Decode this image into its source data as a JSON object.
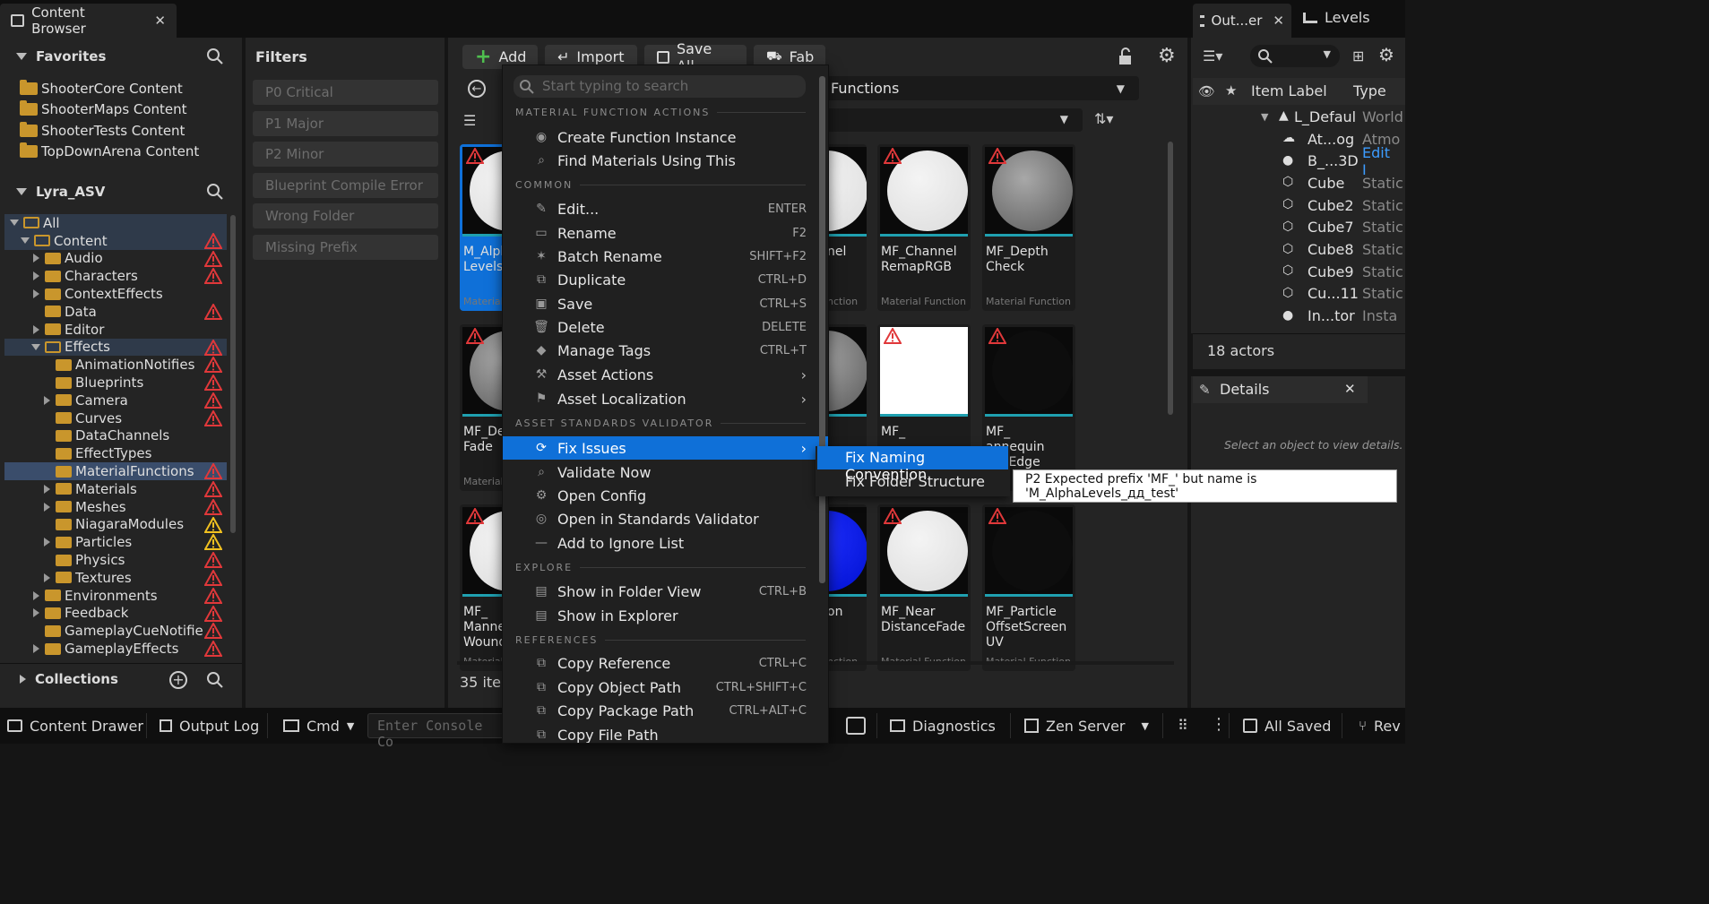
{
  "tabs": {
    "content_browser": "Content Browser",
    "close": "✕",
    "outliner": "Out...er",
    "levels": "Levels"
  },
  "favorites": {
    "title": "Favorites",
    "items": [
      "ShooterCore Content",
      "ShooterMaps Content",
      "ShooterTests Content",
      "TopDownArena Content"
    ]
  },
  "project": {
    "title": "Lyra_ASV"
  },
  "tree": [
    {
      "label": "All",
      "depth": 0,
      "exp": "open",
      "warn": ""
    },
    {
      "label": "Content",
      "depth": 1,
      "exp": "open",
      "warn": "red"
    },
    {
      "label": "Audio",
      "depth": 2,
      "exp": "closed",
      "warn": "red"
    },
    {
      "label": "Characters",
      "depth": 2,
      "exp": "closed",
      "warn": "red"
    },
    {
      "label": "ContextEffects",
      "depth": 2,
      "exp": "closed",
      "warn": ""
    },
    {
      "label": "Data",
      "depth": 2,
      "exp": "none",
      "warn": "red"
    },
    {
      "label": "Editor",
      "depth": 2,
      "exp": "closed",
      "warn": ""
    },
    {
      "label": "Effects",
      "depth": 2,
      "exp": "open",
      "warn": "red"
    },
    {
      "label": "AnimationNotifies",
      "depth": 3,
      "exp": "none",
      "warn": "red"
    },
    {
      "label": "Blueprints",
      "depth": 3,
      "exp": "none",
      "warn": "red"
    },
    {
      "label": "Camera",
      "depth": 3,
      "exp": "closed",
      "warn": "red"
    },
    {
      "label": "Curves",
      "depth": 3,
      "exp": "none",
      "warn": "red"
    },
    {
      "label": "DataChannels",
      "depth": 3,
      "exp": "none",
      "warn": ""
    },
    {
      "label": "EffectTypes",
      "depth": 3,
      "exp": "none",
      "warn": ""
    },
    {
      "label": "MaterialFunctions",
      "depth": 3,
      "exp": "none",
      "warn": "red"
    },
    {
      "label": "Materials",
      "depth": 3,
      "exp": "closed",
      "warn": "red"
    },
    {
      "label": "Meshes",
      "depth": 3,
      "exp": "closed",
      "warn": "red"
    },
    {
      "label": "NiagaraModules",
      "depth": 3,
      "exp": "none",
      "warn": "yellow"
    },
    {
      "label": "Particles",
      "depth": 3,
      "exp": "closed",
      "warn": "yellow"
    },
    {
      "label": "Physics",
      "depth": 3,
      "exp": "none",
      "warn": "red"
    },
    {
      "label": "Textures",
      "depth": 3,
      "exp": "closed",
      "warn": "red"
    },
    {
      "label": "Environments",
      "depth": 2,
      "exp": "closed",
      "warn": "red"
    },
    {
      "label": "Feedback",
      "depth": 2,
      "exp": "closed",
      "warn": "red"
    },
    {
      "label": "GameplayCueNotifie",
      "depth": 2,
      "exp": "none",
      "warn": "red"
    },
    {
      "label": "GameplayEffects",
      "depth": 2,
      "exp": "closed",
      "warn": "red"
    }
  ],
  "collections": {
    "title": "Collections"
  },
  "filters": {
    "title": "Filters",
    "items": [
      "P0 Critical",
      "P1 Major",
      "P2 Minor",
      "Blueprint Compile Error",
      "Wrong Folder",
      "Missing Prefix"
    ]
  },
  "toolbar": {
    "add": "Add",
    "import": "Import",
    "save_all": "Save All",
    "fab": "Fab"
  },
  "path": {
    "functions": "Functions"
  },
  "tiles": [
    {
      "name": "M_Alpha\nLevels",
      "kind": "Material",
      "style": "white",
      "sel": true
    },
    {
      "name": "MF_Channel\nRemapRGB",
      "kind": "Material Function",
      "style": "white"
    },
    {
      "name": "MF_Depth\nCheck",
      "kind": "Material Function",
      "style": "checker"
    },
    {
      "name": "MF_De\nFade",
      "kind": "Material",
      "style": "checker"
    },
    {
      "name": "MF_",
      "kind": "",
      "style": "square"
    },
    {
      "name": "MF_\nannequin\nnchEdge",
      "kind": "",
      "style": "black"
    },
    {
      "name": "MF_\nManne\nWound",
      "kind": "Material",
      "style": "white"
    },
    {
      "name": "MF_Near\nDistanceFade",
      "kind": "Material Function",
      "style": "white"
    },
    {
      "name": "MF_Particle\nOffsetScreen\nUV",
      "kind": "Material Function",
      "style": "black"
    }
  ],
  "partial": {
    "p1": "nel",
    "p2": "nction",
    "p3": "on",
    "p4": "nction"
  },
  "item_count": "35 iter",
  "menu": {
    "search_placeholder": "Start typing to search",
    "sections": {
      "mf": "MATERIAL FUNCTION ACTIONS",
      "common": "COMMON",
      "asv": "ASSET STANDARDS VALIDATOR",
      "explore": "EXPLORE",
      "references": "REFERENCES"
    },
    "items": [
      {
        "label": "Create Function Instance",
        "sc": "",
        "icon": "palette-icon"
      },
      {
        "label": "Find Materials Using This",
        "sc": "",
        "icon": "magnifier-icon"
      },
      {
        "label": "Edit...",
        "sc": "ENTER",
        "icon": "pencil-icon"
      },
      {
        "label": "Rename",
        "sc": "F2",
        "icon": "rename-icon"
      },
      {
        "label": "Batch Rename",
        "sc": "SHIFT+F2",
        "icon": "sparkle-icon"
      },
      {
        "label": "Duplicate",
        "sc": "CTRL+D",
        "icon": "duplicate-icon"
      },
      {
        "label": "Save",
        "sc": "CTRL+S",
        "icon": "save-icon"
      },
      {
        "label": "Delete",
        "sc": "DELETE",
        "icon": "trash-icon"
      },
      {
        "label": "Manage Tags",
        "sc": "CTRL+T",
        "icon": "tag-icon"
      },
      {
        "label": "Asset Actions",
        "sc": "",
        "icon": "wrench-icon",
        "arrow": true
      },
      {
        "label": "Asset Localization",
        "sc": "",
        "icon": "flag-icon",
        "arrow": true
      },
      {
        "label": "Fix Issues",
        "sc": "",
        "icon": "refresh-icon",
        "arrow": true,
        "active": true
      },
      {
        "label": "Validate Now",
        "sc": "",
        "icon": "search-icon"
      },
      {
        "label": "Open Config",
        "sc": "",
        "icon": "gear-icon"
      },
      {
        "label": "Open in Standards Validator",
        "sc": "",
        "icon": "eye-icon"
      },
      {
        "label": "Add to Ignore List",
        "sc": "",
        "icon": "minus-icon"
      },
      {
        "label": "Show in Folder View",
        "sc": "CTRL+B",
        "icon": "folder-view-icon"
      },
      {
        "label": "Show in Explorer",
        "sc": "",
        "icon": "explorer-icon"
      },
      {
        "label": "Copy Reference",
        "sc": "CTRL+C",
        "icon": "copy-icon"
      },
      {
        "label": "Copy Object Path",
        "sc": "CTRL+SHIFT+C",
        "icon": "copy-icon"
      },
      {
        "label": "Copy Package Path",
        "sc": "CTRL+ALT+C",
        "icon": "copy-icon"
      },
      {
        "label": "Copy File Path",
        "sc": "",
        "icon": "copy-icon"
      }
    ]
  },
  "submenu": {
    "items": [
      "Fix Naming Convention",
      "Fix Folder Structure"
    ]
  },
  "tooltip": {
    "text": "P2  Expected prefix 'MF_' but name is 'M_AlphaLevels_дд_test'"
  },
  "outliner": {
    "col_label": "Item Label",
    "col_type": "Type",
    "rows": [
      {
        "name": "L_Defaul",
        "type": "World",
        "icon": "level-icon"
      },
      {
        "name": "At...og",
        "type": "Atmo",
        "icon": "fog-icon"
      },
      {
        "name": "B_...3D",
        "type": "Edit I",
        "icon": "actor-icon",
        "link": true
      },
      {
        "name": "Cube",
        "type": "Static",
        "icon": "cube-icon"
      },
      {
        "name": "Cube2",
        "type": "Static",
        "icon": "cube-icon"
      },
      {
        "name": "Cube7",
        "type": "Static",
        "icon": "cube-icon"
      },
      {
        "name": "Cube8",
        "type": "Static",
        "icon": "cube-icon"
      },
      {
        "name": "Cube9",
        "type": "Static",
        "icon": "cube-icon"
      },
      {
        "name": "Cu...11",
        "type": "Static",
        "icon": "cube-icon"
      },
      {
        "name": "In...tor",
        "type": "Insta",
        "icon": "actor-icon"
      }
    ],
    "actors": "18 actors"
  },
  "details": {
    "title": "Details",
    "hint": "Select an object to view details."
  },
  "statusbar": {
    "content_drawer": "Content Drawer",
    "output_log": "Output Log",
    "cmd": "Cmd",
    "console_placeholder": "Enter Console Co",
    "diagnostics": "Diagnostics",
    "zen": "Zen Server",
    "all_saved": "All Saved",
    "rev": "Rev"
  },
  "colors": {
    "accent": "#0f70d8",
    "warn_red": "#e0383a",
    "warn_yellow": "#f0c020",
    "folder": "#c9962c"
  }
}
